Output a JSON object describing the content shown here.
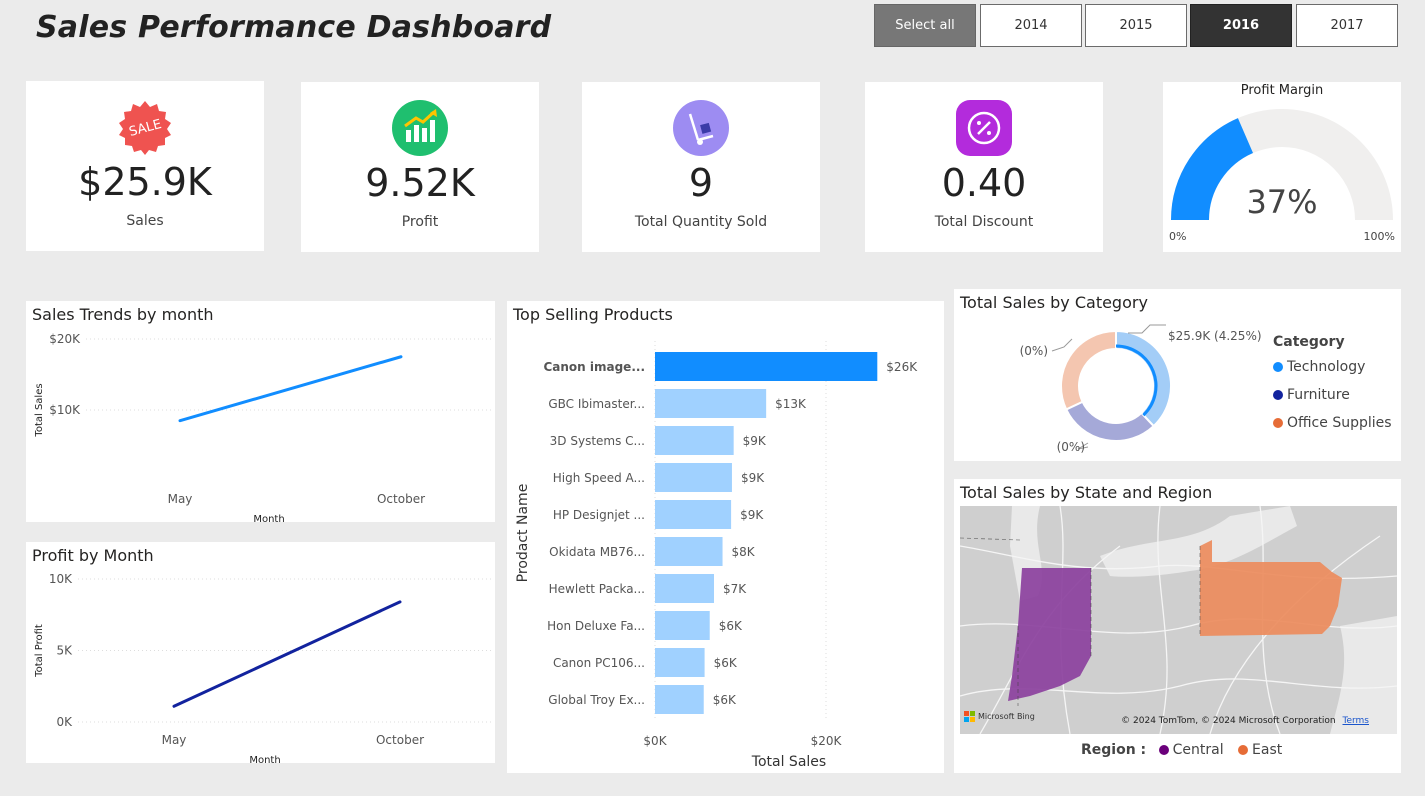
{
  "header": {
    "title": "Sales Performance Dashboard"
  },
  "slicer": {
    "buttons": [
      "Select all",
      "2014",
      "2015",
      "2016",
      "2017"
    ],
    "selected": "2016"
  },
  "kpis": [
    {
      "value": "$25.9K",
      "label": "Sales",
      "icon": "sale-badge-icon"
    },
    {
      "value": "9.52K",
      "label": "Profit",
      "icon": "growth-chart-icon"
    },
    {
      "value": "9",
      "label": "Total Quantity Sold",
      "icon": "hand-truck-icon"
    },
    {
      "value": "0.40",
      "label": "Total Discount",
      "icon": "discount-percent-icon"
    }
  ],
  "gauge": {
    "title": "Profit Margin",
    "value_label": "37%",
    "value": 0.37,
    "min_label": "0%",
    "max_label": "100%",
    "color": "#118dff",
    "track_color": "#f0efee"
  },
  "sales_trend": {
    "title": "Sales Trends by month",
    "chart_data": {
      "type": "line",
      "x": [
        "May",
        "October"
      ],
      "series": [
        {
          "values": [
            8500,
            17500
          ],
          "color": "#118dff"
        }
      ],
      "xlabel": "Month",
      "ylabel": "Total Sales",
      "yticks": [
        "$10K",
        "$20K"
      ],
      "ylim": [
        0,
        20000
      ]
    }
  },
  "profit_month": {
    "title": "Profit by Month",
    "chart_data": {
      "type": "line",
      "x": [
        "May",
        "October"
      ],
      "series": [
        {
          "values": [
            1100,
            8400
          ],
          "color": "#12239e"
        }
      ],
      "xlabel": "Month",
      "ylabel": "Total Profit",
      "yticks": [
        "0K",
        "5K",
        "10K"
      ],
      "ylim": [
        0,
        10000
      ]
    }
  },
  "top_products": {
    "title": "Top Selling Products",
    "chart_data": {
      "type": "bar",
      "categories": [
        "Canon image...",
        "GBC Ibimaster...",
        "3D Systems C...",
        "High Speed A...",
        "HP Designjet ...",
        "Okidata MB76...",
        "Hewlett Packa...",
        "Hon Deluxe Fa...",
        "Canon PC106...",
        "Global Troy Ex..."
      ],
      "values": [
        26,
        13,
        9.2,
        9,
        8.9,
        7.9,
        6.9,
        6.4,
        5.8,
        5.7
      ],
      "data_labels": [
        "$26K",
        "$13K",
        "$9K",
        "$9K",
        "$9K",
        "$8K",
        "$7K",
        "$6K",
        "$6K",
        "$6K"
      ],
      "xlabel": "Total Sales",
      "ylabel": "Prodact Name",
      "xticks": [
        "$0K",
        "$20K"
      ],
      "xlim": [
        0,
        29
      ],
      "highlight_color": "#118dff",
      "bar_color": "#a0d1ff"
    }
  },
  "category": {
    "title": "Total Sales by Category",
    "chart_data": {
      "type": "pie",
      "labels": [
        "Technology",
        "Furniture",
        "Office Supplies"
      ],
      "values": [
        0.38,
        0.3,
        0.32
      ],
      "colors": [
        "#118dff",
        "#12239e",
        "#e66c37"
      ],
      "slice_colors": [
        "#a3cdf7",
        "#a5a9d8",
        "#f4c6b0"
      ],
      "data_labels": [
        "$25.9K (4.25%)",
        "(0%)",
        "(0%)"
      ]
    },
    "legend_title": "Category"
  },
  "map": {
    "title": "Total Sales by State and Region",
    "legend_title": "Region :",
    "regions": [
      {
        "name": "Central",
        "color": "#6b007b"
      },
      {
        "name": "East",
        "color": "#e66c37"
      }
    ],
    "attribution": "© 2024 TomTom, © 2024 Microsoft Corporation",
    "terms": "Terms",
    "brand": "Microsoft Bing"
  }
}
